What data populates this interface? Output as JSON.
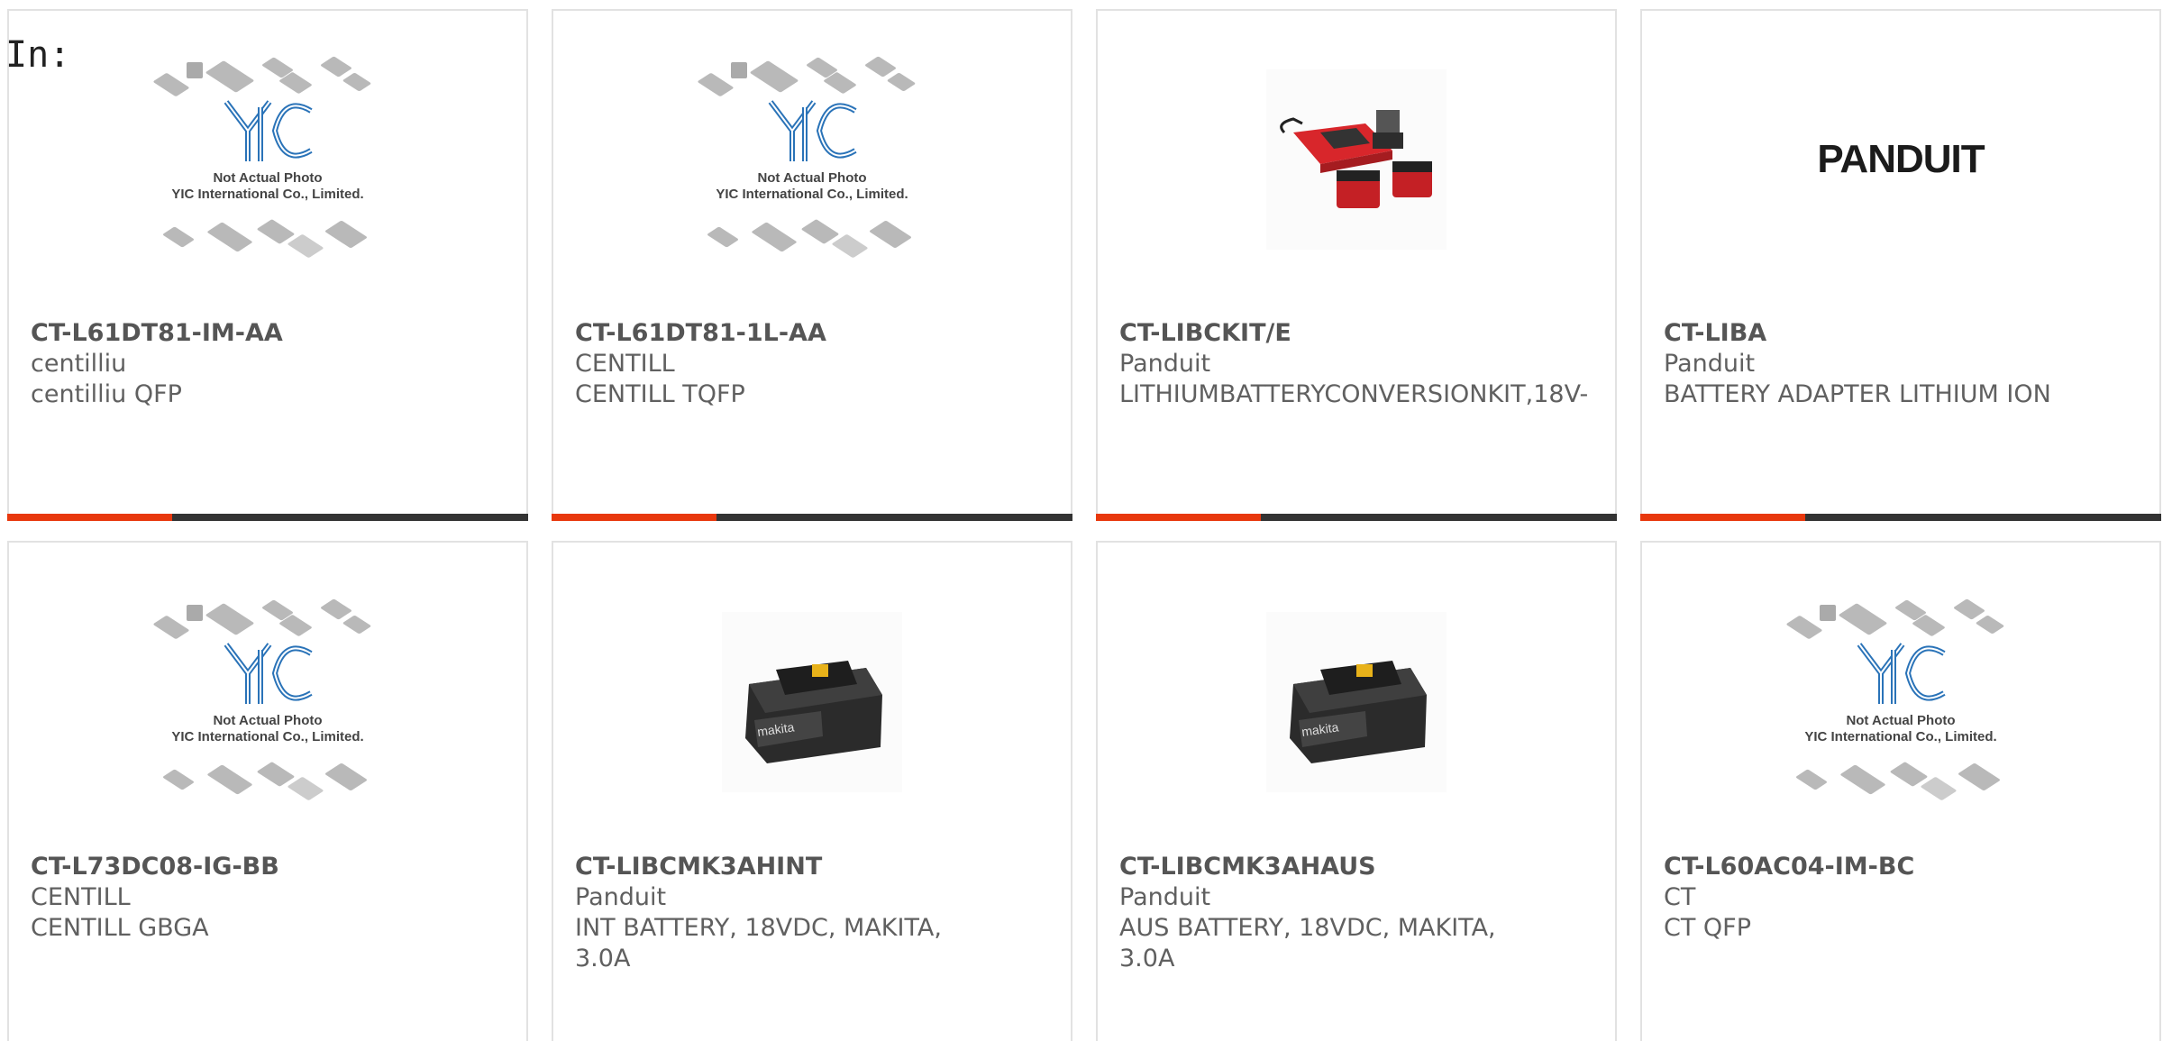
{
  "filter_label": "In:",
  "placeholder_caption": {
    "line1": "Not Actual Photo",
    "line2": "YIC International Co., Limited."
  },
  "brand_logo_text": "PANDUIT",
  "colors": {
    "accent": "#e8380d",
    "bar": "#333333"
  },
  "products": [
    {
      "part": "CT-L61DT81-IM-AA",
      "maker": "centilliu",
      "desc": "centilliu QFP",
      "image": "placeholder"
    },
    {
      "part": "CT-L61DT81-1L-AA",
      "maker": "CENTILL",
      "desc": "CENTILL TQFP",
      "image": "placeholder"
    },
    {
      "part": "CT-LIBCKIT/E",
      "maker": "Panduit",
      "desc": "LITHIUMBATTERYCONVERSIONKIT,18V-",
      "image": "charger-kit-photo"
    },
    {
      "part": "CT-LIBA",
      "maker": "Panduit",
      "desc": "BATTERY ADAPTER LITHIUM ION",
      "image": "panduit-logo"
    },
    {
      "part": "CT-L73DC08-IG-BB",
      "maker": "CENTILL",
      "desc": "CENTILL GBGA",
      "image": "placeholder"
    },
    {
      "part": "CT-LIBCMK3AHINT",
      "maker": "Panduit",
      "desc": "INT BATTERY, 18VDC, MAKITA,",
      "desc2": "3.0A",
      "image": "battery-photo"
    },
    {
      "part": "CT-LIBCMK3AHAUS",
      "maker": "Panduit",
      "desc": "AUS BATTERY, 18VDC, MAKITA,",
      "desc2": "3.0A",
      "image": "battery-photo"
    },
    {
      "part": "CT-L60AC04-IM-BC",
      "maker": "CT",
      "desc": "CT QFP",
      "image": "placeholder"
    }
  ]
}
